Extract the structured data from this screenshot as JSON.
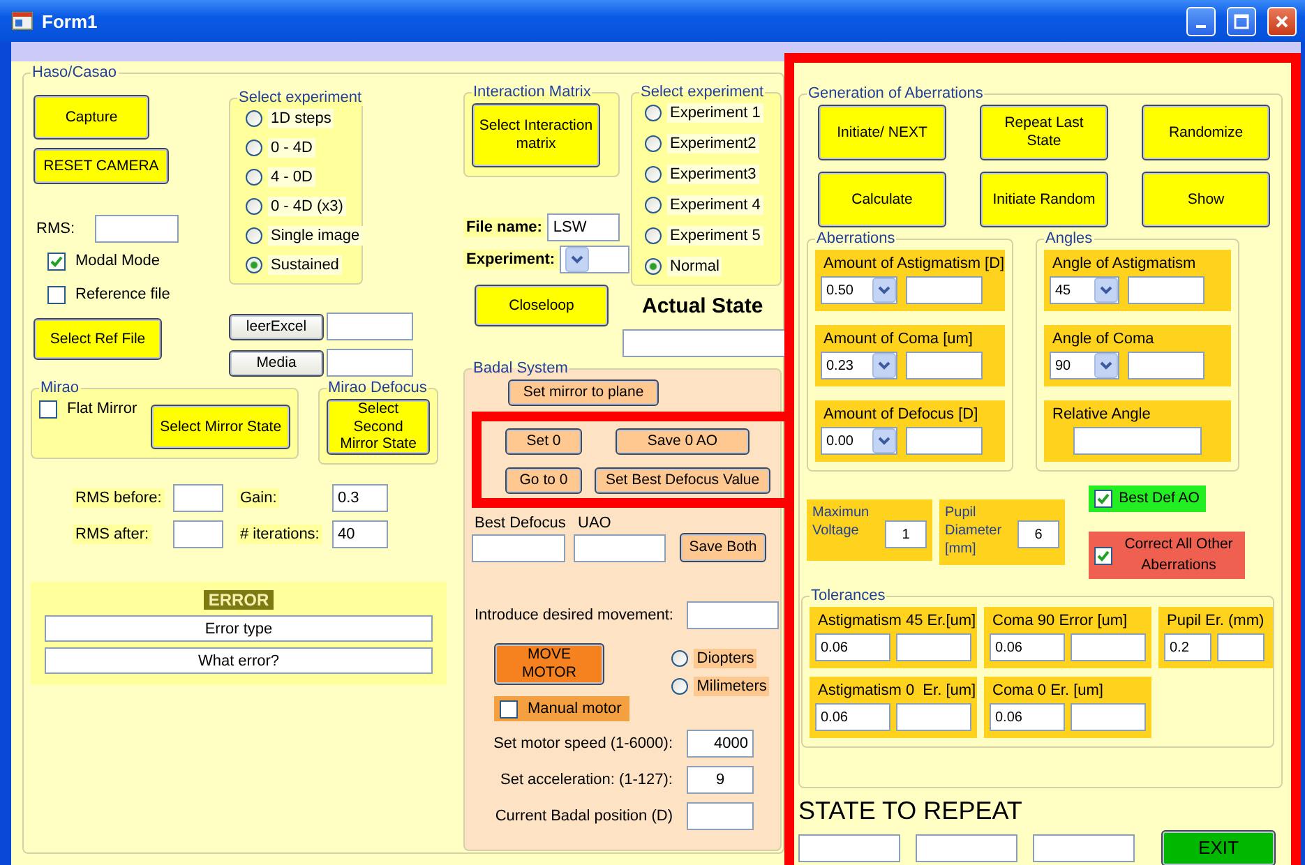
{
  "window": {
    "title": "Form1"
  },
  "haso": {
    "title": "Haso/Casao",
    "capture": "Capture",
    "reset_camera": "RESET CAMERA",
    "rms_label": "RMS:",
    "checkboxes": [
      {
        "label": "Modal Mode",
        "checked": true
      },
      {
        "label": "Reference file",
        "checked": false
      }
    ],
    "experiment": {
      "title": "Select experiment",
      "options": [
        {
          "label": "1D steps",
          "selected": false
        },
        {
          "label": "0 - 4D",
          "selected": false
        },
        {
          "label": "4 - 0D",
          "selected": false
        },
        {
          "label": "0 - 4D (x3)",
          "selected": false
        },
        {
          "label": "Single image",
          "selected": false
        },
        {
          "label": "Sustained",
          "selected": true
        }
      ]
    },
    "select_ref_file": "Select Ref File",
    "file_buttons": [
      "leerExcel",
      "Media"
    ],
    "mirao": {
      "title": "Mirao",
      "flat_mirror": {
        "label": "Flat Mirror",
        "checked": false
      },
      "button": "Select Mirror State"
    },
    "mirao_defocus": {
      "title": "Mirao Defocus",
      "button": "Select Second Mirror State"
    },
    "stats": [
      {
        "label": "RMS before:"
      },
      {
        "label": "Gain:",
        "value": "0.3"
      },
      {
        "label": "RMS after:"
      },
      {
        "label": "# iterations:",
        "value": "40"
      }
    ],
    "error": {
      "title": "ERROR",
      "lines": [
        "Error type",
        "What error?"
      ]
    }
  },
  "interaction_matrix": {
    "title": "Interaction Matrix",
    "button": "Select Interaction matrix"
  },
  "file_name": {
    "label": "File name:",
    "value": "LSW"
  },
  "experiment_select": {
    "label": "Experiment:"
  },
  "closeloop": "Closeloop",
  "experiment_2": {
    "title": "Select experiment",
    "options": [
      {
        "label": "Experiment 1",
        "selected": false
      },
      {
        "label": "Experiment2",
        "selected": false
      },
      {
        "label": "Experiment3",
        "selected": false
      },
      {
        "label": "Experiment 4",
        "selected": false
      },
      {
        "label": "Experiment 5",
        "selected": false
      },
      {
        "label": "Normal",
        "selected": true
      }
    ]
  },
  "actual_state": {
    "label": "Actual State"
  },
  "badal": {
    "title": "Badal System",
    "set_mirror": "Set mirror to plane",
    "button_rows": [
      {
        "left": "Set 0",
        "right": "Save 0 AO"
      },
      {
        "left": "Go to 0",
        "right": "Set Best Defocus Value"
      }
    ],
    "value_labels": [
      "Best Defocus",
      "UAO"
    ],
    "save_both": "Save Both",
    "movement_label": "Introduce desired movement:",
    "move_motor": "MOVE MOTOR",
    "units": [
      {
        "label": "Diopters",
        "selected": false
      },
      {
        "label": "Milimeters",
        "selected": false
      }
    ],
    "manual_motor": {
      "label": "Manual motor",
      "checked": false
    },
    "settings": [
      {
        "label": "Set motor speed (1-6000):",
        "value": "4000"
      },
      {
        "label": "Set acceleration: (1-127):",
        "value": "9"
      },
      {
        "label": "Current Badal position (D)"
      }
    ]
  },
  "generation": {
    "title": "Generation of Aberrations",
    "buttons": [
      "Initiate/ NEXT",
      "Repeat Last State",
      "Randomize",
      "Calculate",
      "Initiate Random",
      "Show"
    ],
    "aberrations": {
      "title": "Aberrations",
      "items": [
        {
          "label": "Amount of Astigmatism [D]",
          "value": "0.50"
        },
        {
          "label": "Amount of Coma [um]",
          "value": "0.23"
        },
        {
          "label": "Amount of Defocus [D]",
          "value": "0.00"
        }
      ]
    },
    "angles": {
      "title": "Angles",
      "items": [
        {
          "kind": "combo",
          "label": "Angle of Astigmatism",
          "value": "45"
        },
        {
          "kind": "combo",
          "label": "Angle of Coma",
          "value": "90"
        },
        {
          "kind": "field",
          "label": "Relative Angle"
        }
      ]
    },
    "parameters": [
      {
        "label": "Maximun Voltage",
        "value": "1"
      },
      {
        "label": "Pupil Diameter [mm]",
        "value": "6"
      }
    ],
    "options": [
      {
        "label": "Best Def AO",
        "checked": true,
        "color": "#22ee22"
      },
      {
        "label": "Correct All Other Aberrations",
        "checked": true,
        "color": "#f06050"
      }
    ],
    "tolerances": {
      "title": "Tolerances",
      "rows": [
        [
          {
            "label": "Astigmatism 45 Er.[um]",
            "value": "0.06"
          },
          {
            "label": "Coma 90 Error [um]",
            "value": "0.06"
          },
          {
            "label": "Pupil Er. (mm)",
            "value": "0.2"
          }
        ],
        [
          {
            "label": "Astigmatism 0  Er. [um]",
            "value": "0.06"
          },
          {
            "label": "Coma 0 Er. [um]",
            "value": "0.06"
          }
        ]
      ]
    }
  },
  "state_to_repeat": {
    "label": "STATE TO REPEAT"
  },
  "exit": "EXIT"
}
